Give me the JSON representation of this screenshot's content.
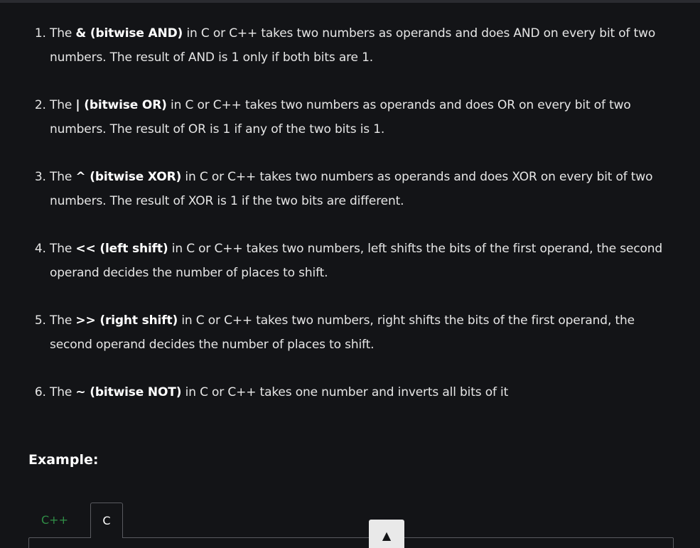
{
  "operators": [
    {
      "before": "The ",
      "op": "& (bitwise AND)",
      "after": " in C or C++ takes two numbers as operands and does AND on every bit of two numbers. The result of AND is 1 only if both bits are 1."
    },
    {
      "before": "The ",
      "op": "| (bitwise OR)",
      "after": " in C or C++ takes two numbers as operands and does OR on every bit of two numbers. The result of OR is 1 if any of the two bits is 1."
    },
    {
      "before": "The ",
      "op": "^ (bitwise XOR)",
      "after": " in C or C++ takes two numbers as operands and does XOR on every bit of two numbers. The result of XOR is 1 if the two bits are different."
    },
    {
      "before": "The ",
      "op": "<< (left shift)",
      "after": " in C or C++ takes two numbers, left shifts the bits of the first operand, the second operand decides the number of places to shift."
    },
    {
      "before": "The ",
      "op": ">> (right shift)",
      "after": " in C or C++ takes two numbers, right shifts the bits of the first operand, the second operand decides the number of places to shift."
    },
    {
      "before": "The ",
      "op": "~ (bitwise NOT)",
      "after": " in C or C++ takes one number and inverts all bits of it"
    }
  ],
  "example": {
    "heading": "Example:",
    "tabs": [
      {
        "label": "C++",
        "active": false
      },
      {
        "label": "C",
        "active": true
      }
    ]
  },
  "scroll_button": {
    "glyph": "▲",
    "icon": "arrow-up-icon"
  },
  "colors": {
    "background": "#131417",
    "text": "#e6e6e6",
    "accent_green": "#2f8d46"
  }
}
